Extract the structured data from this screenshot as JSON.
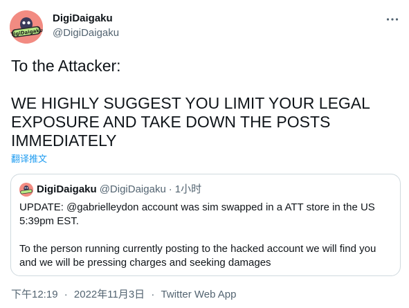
{
  "author": {
    "display_name": "DigiDaigaku",
    "handle": "@DigiDaigaku",
    "avatar_text": "DigiDaigaku"
  },
  "menu": {
    "icon": "more-horizontal-icon"
  },
  "tweet": {
    "text": "To the Attacker:\n\nWE HIGHLY SUGGEST YOU LIMIT YOUR LEGAL EXPOSURE AND TAKE DOWN THE POSTS IMMEDIATELY",
    "translate_label": "翻译推文"
  },
  "quote": {
    "display_name": "DigiDaigaku",
    "handle": "@DigiDaigaku",
    "separator": "·",
    "time": "1小时",
    "text": "UPDATE: @gabrielleydon account was sim swapped in a ATT store in the US 5:39pm EST.\n\nTo the person running currently posting to the hacked account we will find you and we will be pressing charges and seeking damages"
  },
  "meta": {
    "time": "下午12:19",
    "separator": "·",
    "date": "2022年11月3日",
    "source": "Twitter Web App"
  },
  "colors": {
    "text": "#0f1419",
    "secondary": "#536471",
    "link": "#1d9bf0",
    "border": "#cfd9de",
    "avatar_bg": "#f28b82"
  }
}
